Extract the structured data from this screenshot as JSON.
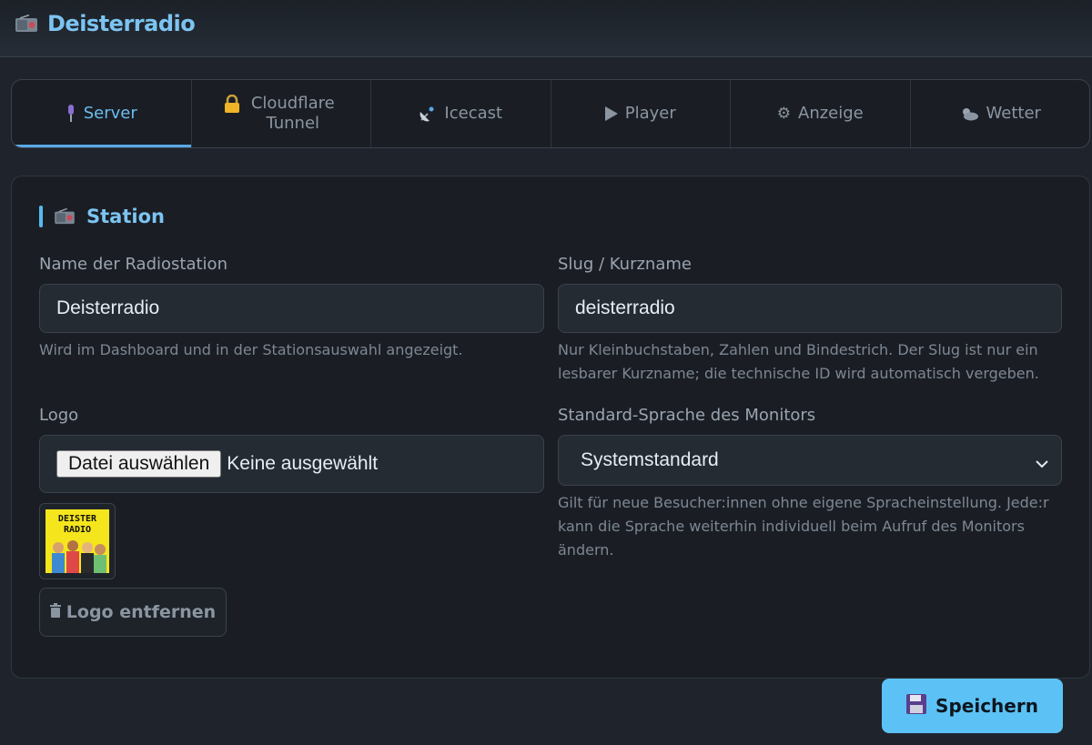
{
  "app": {
    "title": "Deisterradio",
    "icon": "radio-icon"
  },
  "tabs": [
    {
      "label": "Server",
      "icon": "microphone-icon",
      "active": true
    },
    {
      "label": "Cloudflare Tunnel",
      "icon": "lock-icon",
      "active": false
    },
    {
      "label": "Icecast",
      "icon": "satellite-dish-icon",
      "active": false
    },
    {
      "label": "Player",
      "icon": "play-icon",
      "active": false
    },
    {
      "label": "Anzeige",
      "icon": "gear-icon",
      "active": false
    },
    {
      "label": "Wetter",
      "icon": "cloud-sun-icon",
      "active": false
    }
  ],
  "section": {
    "title": "Station",
    "icon": "radio-icon"
  },
  "fields": {
    "name": {
      "label": "Name der Radiostation",
      "value": "Deisterradio",
      "hint": "Wird im Dashboard und in der Stationsauswahl angezeigt."
    },
    "slug": {
      "label": "Slug / Kurzname",
      "value": "deisterradio",
      "hint": "Nur Kleinbuchstaben, Zahlen und Bindestrich. Der Slug ist nur ein lesbarer Kurzname; die technische ID wird automatisch vergeben."
    },
    "logo": {
      "label": "Logo",
      "button": "Datei auswählen",
      "status": "Keine ausgewählt",
      "thumb_text_line1": "DEISTER",
      "thumb_text_line2": "RADIO",
      "remove_label": "Logo entfernen"
    },
    "language": {
      "label": "Standard-Sprache des Monitors",
      "value": "Systemstandard",
      "hint": "Gilt für neue Besucher:innen ohne eigene Spracheinstellung. Jede:r kann die Sprache weiterhin individuell beim Aufruf des Monitors ändern."
    }
  },
  "actions": {
    "save_label": "Speichern"
  },
  "colors": {
    "accent": "#5cc2f5",
    "background": "#1f242c",
    "card": "#1a1e24"
  }
}
